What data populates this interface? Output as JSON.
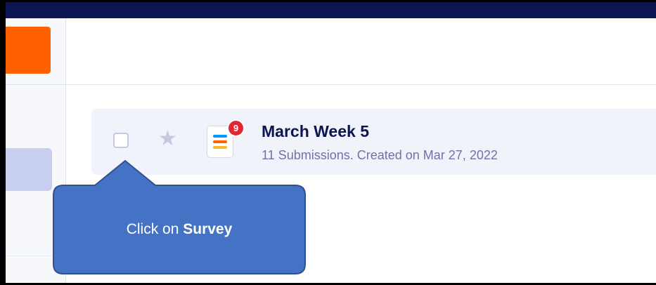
{
  "form": {
    "title": "March Week 5",
    "subtitle": "11 Submissions. Created on Mar 27, 2022",
    "badge_count": "9",
    "star_icon": "star-icon",
    "form_icon": "form-icon"
  },
  "callout": {
    "prefix": "Click on ",
    "bold": "Survey"
  },
  "colors": {
    "top_bar": "#0a1551",
    "accent_orange": "#ff6100",
    "badge_red": "#e3262f",
    "callout_blue": "#4472c4"
  }
}
